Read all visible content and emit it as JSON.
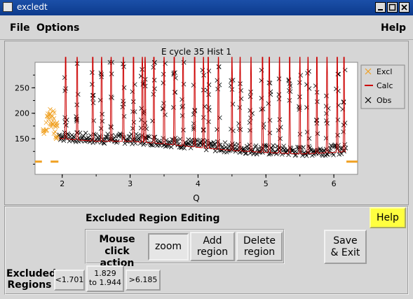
{
  "window": {
    "title": "excledt"
  },
  "menu": {
    "file": "File",
    "options": "Options",
    "help": "Help"
  },
  "plot": {
    "title": "E cycle 35 Hist 1",
    "xlabel": "Q",
    "legend": [
      "Excl",
      "Calc",
      "Obs"
    ]
  },
  "colors": {
    "excl": "#f0a020",
    "calc": "#cc0000",
    "obs": "#000000",
    "help_button": "#ffff40"
  },
  "chart_data": {
    "type": "scatter",
    "title": "E cycle 35 Hist 1",
    "xlabel": "Q",
    "ylabel": "",
    "xlim": [
      1.6,
      6.35
    ],
    "ylim": [
      80,
      300
    ],
    "x_ticks": [
      2,
      3,
      4,
      5,
      6
    ],
    "y_ticks": [
      150,
      200,
      250
    ],
    "series": [
      {
        "name": "Excl",
        "points": [
          [
            1.73,
            165
          ],
          [
            1.76,
            175
          ],
          [
            1.79,
            190
          ],
          [
            1.81,
            200
          ],
          [
            1.83,
            185
          ],
          [
            1.85,
            178
          ],
          [
            1.87,
            195
          ],
          [
            1.89,
            170
          ],
          [
            1.91,
            160
          ],
          [
            1.93,
            172
          ]
        ]
      },
      {
        "name": "Calc",
        "peaks": [
          2.05,
          2.22,
          2.45,
          2.58,
          2.72,
          2.9,
          3.05,
          3.18,
          3.22,
          3.35,
          3.5,
          3.65,
          3.78,
          3.95,
          4.08,
          4.15,
          4.3,
          4.5,
          4.62,
          4.78,
          4.95,
          5.05,
          5.2,
          5.35,
          5.5,
          5.62,
          5.75,
          5.9,
          6.05,
          6.15
        ]
      },
      {
        "name": "Obs",
        "baseline": [
          [
            1.7,
            165
          ],
          [
            2.0,
            155
          ],
          [
            2.5,
            150
          ],
          [
            3.0,
            150
          ],
          [
            3.5,
            145
          ],
          [
            4.0,
            138
          ],
          [
            4.5,
            132
          ],
          [
            5.0,
            128
          ],
          [
            5.5,
            125
          ],
          [
            6.0,
            128
          ],
          [
            6.2,
            130
          ]
        ]
      }
    ],
    "excluded_regions": [
      [
        1.6,
        1.701
      ],
      [
        1.829,
        1.944
      ],
      [
        6.185,
        6.35
      ]
    ]
  },
  "editing": {
    "title": "Excluded Region Editing",
    "mouse_click_action": "Mouse click\naction",
    "zoom": "zoom",
    "add_region": "Add\nregion",
    "delete_region": "Delete\nregion",
    "save_exit": "Save\n& Exit",
    "help": "Help",
    "excluded_regions_label": "Excluded\nRegions",
    "regions": [
      "<1.701",
      "1.829\nto 1.944",
      ">6.185"
    ]
  }
}
